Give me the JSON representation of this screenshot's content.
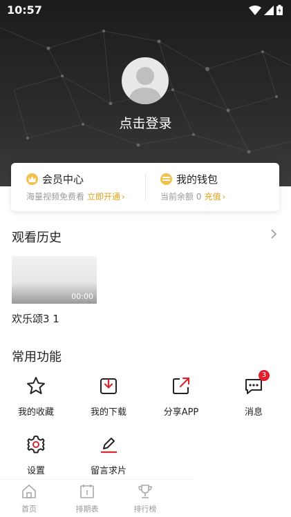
{
  "status_bar": {
    "time": "10:57"
  },
  "profile": {
    "login_text": "点击登录"
  },
  "vip_card": {
    "member": {
      "title": "会员中心",
      "subtitle": "海量视频免费看",
      "action": "立即开通"
    },
    "wallet": {
      "title": "我的钱包",
      "subtitle": "当前余额 0",
      "action": "充值"
    }
  },
  "history": {
    "title": "观看历史",
    "items": [
      {
        "title": "欢乐颂3 1",
        "duration": "00:00"
      }
    ]
  },
  "functions": {
    "title": "常用功能",
    "items": [
      {
        "label": "我的收藏",
        "icon": "star-icon"
      },
      {
        "label": "我的下载",
        "icon": "download-icon"
      },
      {
        "label": "分享APP",
        "icon": "share-icon"
      },
      {
        "label": "消息",
        "icon": "message-icon",
        "badge": "3"
      },
      {
        "label": "设置",
        "icon": "gear-icon"
      },
      {
        "label": "留言求片",
        "icon": "feedback-pen-icon"
      }
    ]
  },
  "tabbar": {
    "items": [
      {
        "label": "首页",
        "icon": "home-icon"
      },
      {
        "label": "排期表",
        "icon": "calendar-icon"
      },
      {
        "label": "排行榜",
        "icon": "trophy-icon"
      }
    ]
  },
  "colors": {
    "accent": "#e0a31a",
    "badge": "#e0202e",
    "hero_bg": "#222222",
    "icon_red": "#d8262e"
  }
}
